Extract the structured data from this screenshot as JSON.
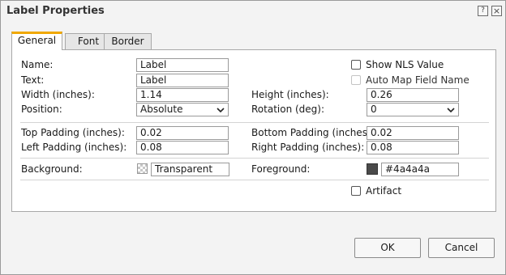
{
  "dialog": {
    "title": "Label Properties",
    "help_glyph": "?",
    "close_glyph": "×"
  },
  "tabs": [
    {
      "label": "General",
      "active": true
    },
    {
      "label": "Font",
      "active": false
    },
    {
      "label": "Border",
      "active": false
    }
  ],
  "general": {
    "name_label": "Name:",
    "name_value": "Label",
    "text_label": "Text:",
    "text_value": "Label",
    "width_label": "Width (inches):",
    "width_value": "1.14",
    "position_label": "Position:",
    "position_value": "Absolute",
    "height_label": "Height (inches):",
    "height_value": "0.26",
    "rotation_label": "Rotation (deg):",
    "rotation_value": "0",
    "show_nls_label": "Show NLS Value",
    "show_nls_checked": false,
    "auto_map_label": "Auto Map Field Name",
    "auto_map_checked": false,
    "auto_map_disabled": true,
    "top_padding_label": "Top Padding (inches):",
    "top_padding_value": "0.02",
    "left_padding_label": "Left Padding (inches):",
    "left_padding_value": "0.08",
    "bottom_padding_label": "Bottom Padding (inches):",
    "bottom_padding_value": "0.02",
    "right_padding_label": "Right Padding (inches):",
    "right_padding_value": "0.08",
    "background_label": "Background:",
    "background_value": "Transparent",
    "foreground_label": "Foreground:",
    "foreground_value": "#4a4a4a",
    "artifact_label": "Artifact",
    "artifact_checked": false
  },
  "buttons": {
    "ok": "OK",
    "cancel": "Cancel"
  },
  "colors": {
    "accent_tab": "#f0a800",
    "foreground_swatch": "#4a4a4a"
  }
}
